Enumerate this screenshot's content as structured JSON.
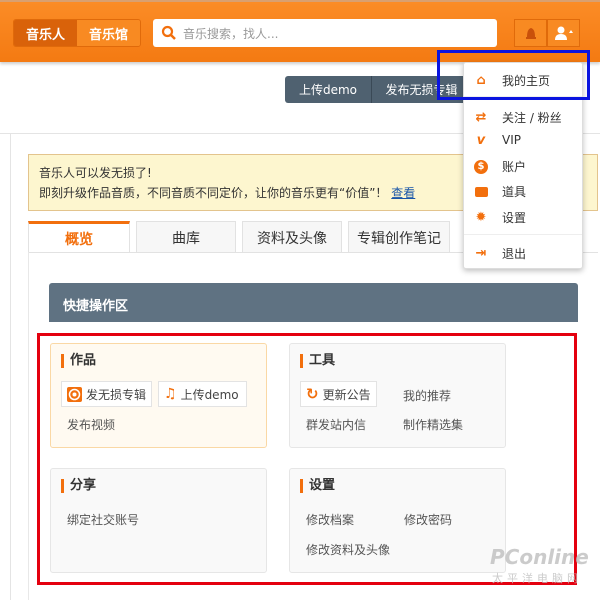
{
  "header": {
    "nav": [
      "音乐人",
      "音乐馆"
    ],
    "search_placeholder": "音乐搜索，找人..."
  },
  "toolbar": {
    "upload_demo": "上传demo",
    "publish_lossless": "发布无损专辑"
  },
  "notice": {
    "line1": "音乐人可以发无损了!",
    "line2": "即刻升级作品音质，不同音质不同定价，让你的音乐更有“价值”！",
    "link": "查看"
  },
  "tabs": [
    "概览",
    "曲库",
    "资料及头像",
    "专辑创作笔记"
  ],
  "quick": {
    "title": "快捷操作区",
    "works": {
      "title": "作品",
      "btn1": "发无损专辑",
      "btn2": "上传demo",
      "link1": "发布视频"
    },
    "tools": {
      "title": "工具",
      "btn1": "更新公告",
      "link1": "我的推荐",
      "link2": "群发站内信",
      "link3": "制作精选集"
    },
    "share": {
      "title": "分享",
      "link1": "绑定社交账号"
    },
    "settings": {
      "title": "设置",
      "link1": "修改档案",
      "link2": "修改密码",
      "link3": "修改资料及头像"
    }
  },
  "dropdown": {
    "items": [
      "我的主页",
      "关注 / 粉丝",
      "VIP",
      "账户",
      "道具",
      "设置",
      "退出"
    ]
  },
  "watermark": {
    "text": "PConline",
    "sub": "太平洋电脑网"
  },
  "colors": {
    "accent": "#f26f0d",
    "header": "#f7861b",
    "panel": "#5f7282"
  }
}
